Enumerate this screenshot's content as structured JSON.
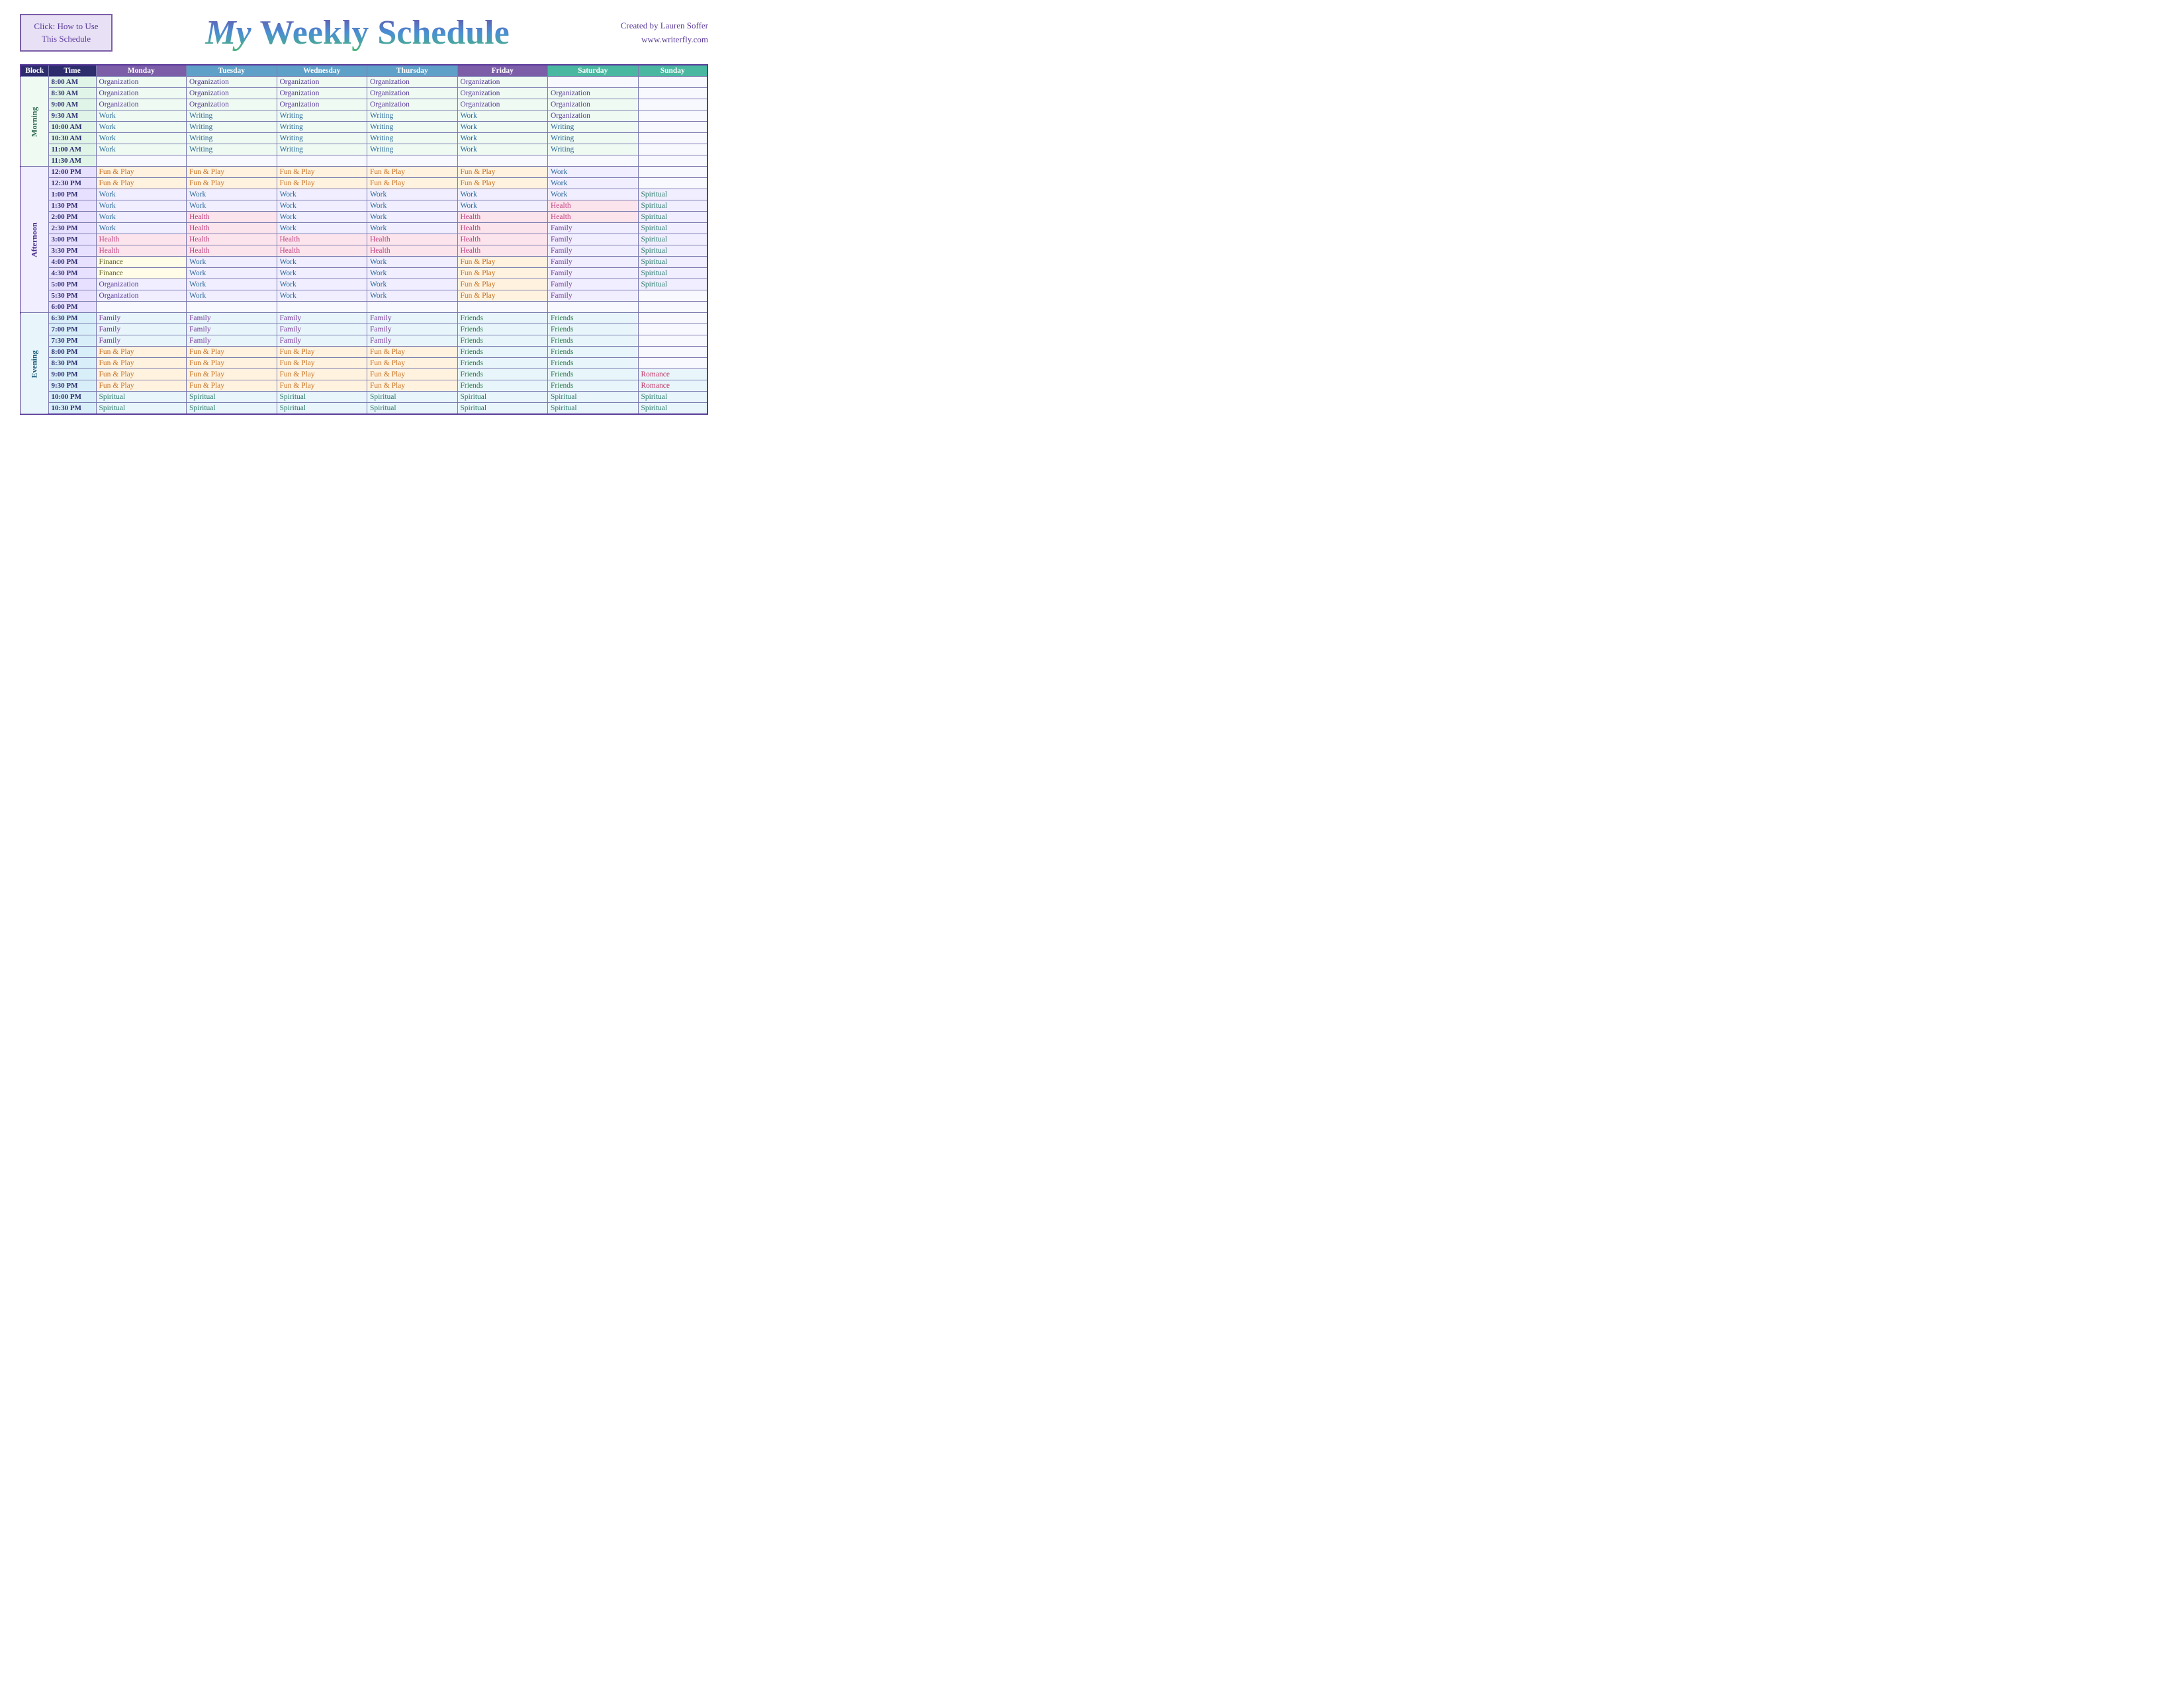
{
  "header": {
    "click_box_line1": "Click:  How to Use",
    "click_box_line2": "This Schedule",
    "title": "My Weekly Schedule",
    "credit_line1": "Created by Lauren Soffer",
    "credit_line2": "www.writerfly.com"
  },
  "table": {
    "columns": [
      "Block",
      "Time",
      "Monday",
      "Tuesday",
      "Wednesday",
      "Thursday",
      "Friday",
      "Saturday",
      "Sunday"
    ],
    "blocks": {
      "morning": "Morning",
      "afternoon": "Afternoon",
      "evening": "Evening"
    },
    "rows": [
      {
        "block": "morning",
        "time": "8:00 AM",
        "mon": "Organization",
        "tue": "Organization",
        "wed": "Organization",
        "thu": "Organization",
        "fri": "Organization",
        "sat": "",
        "sun": ""
      },
      {
        "block": "morning",
        "time": "8:30 AM",
        "mon": "Organization",
        "tue": "Organization",
        "wed": "Organization",
        "thu": "Organization",
        "fri": "Organization",
        "sat": "Organization",
        "sun": ""
      },
      {
        "block": "morning",
        "time": "9:00 AM",
        "mon": "Organization",
        "tue": "Organization",
        "wed": "Organization",
        "thu": "Organization",
        "fri": "Organization",
        "sat": "Organization",
        "sun": ""
      },
      {
        "block": "morning",
        "time": "9:30 AM",
        "mon": "Work",
        "tue": "Writing",
        "wed": "Writing",
        "thu": "Writing",
        "fri": "Work",
        "sat": "Organization",
        "sun": ""
      },
      {
        "block": "morning",
        "time": "10:00 AM",
        "mon": "Work",
        "tue": "Writing",
        "wed": "Writing",
        "thu": "Writing",
        "fri": "Work",
        "sat": "Writing",
        "sun": ""
      },
      {
        "block": "morning",
        "time": "10:30 AM",
        "mon": "Work",
        "tue": "Writing",
        "wed": "Writing",
        "thu": "Writing",
        "fri": "Work",
        "sat": "Writing",
        "sun": ""
      },
      {
        "block": "morning",
        "time": "11:00 AM",
        "mon": "Work",
        "tue": "Writing",
        "wed": "Writing",
        "thu": "Writing",
        "fri": "Work",
        "sat": "Writing",
        "sun": ""
      },
      {
        "block": "morning",
        "time": "11:30 AM",
        "mon": "",
        "tue": "",
        "wed": "",
        "thu": "",
        "fri": "",
        "sat": "",
        "sun": ""
      },
      {
        "block": "afternoon",
        "time": "12:00 PM",
        "mon": "Fun & Play",
        "tue": "Fun & Play",
        "wed": "Fun & Play",
        "thu": "Fun & Play",
        "fri": "Fun & Play",
        "sat": "Work",
        "sun": ""
      },
      {
        "block": "afternoon",
        "time": "12:30 PM",
        "mon": "Fun & Play",
        "tue": "Fun & Play",
        "wed": "Fun & Play",
        "thu": "Fun & Play",
        "fri": "Fun & Play",
        "sat": "Work",
        "sun": ""
      },
      {
        "block": "afternoon",
        "time": "1:00 PM",
        "mon": "Work",
        "tue": "Work",
        "wed": "Work",
        "thu": "Work",
        "fri": "Work",
        "sat": "Work",
        "sun": "Spiritual"
      },
      {
        "block": "afternoon",
        "time": "1:30 PM",
        "mon": "Work",
        "tue": "Work",
        "wed": "Work",
        "thu": "Work",
        "fri": "Work",
        "sat": "Health",
        "sun": "Spiritual"
      },
      {
        "block": "afternoon",
        "time": "2:00 PM",
        "mon": "Work",
        "tue": "Health",
        "wed": "Work",
        "thu": "Work",
        "fri": "Health",
        "sat": "Health",
        "sun": "Spiritual"
      },
      {
        "block": "afternoon",
        "time": "2:30 PM",
        "mon": "Work",
        "tue": "Health",
        "wed": "Work",
        "thu": "Work",
        "fri": "Health",
        "sat": "Family",
        "sun": "Spiritual"
      },
      {
        "block": "afternoon",
        "time": "3:00 PM",
        "mon": "Health",
        "tue": "Health",
        "wed": "Health",
        "thu": "Health",
        "fri": "Health",
        "sat": "Family",
        "sun": "Spiritual"
      },
      {
        "block": "afternoon",
        "time": "3:30 PM",
        "mon": "Health",
        "tue": "Health",
        "wed": "Health",
        "thu": "Health",
        "fri": "Health",
        "sat": "Family",
        "sun": "Spiritual"
      },
      {
        "block": "afternoon",
        "time": "4:00 PM",
        "mon": "Finance",
        "tue": "Work",
        "wed": "Work",
        "thu": "Work",
        "fri": "Fun & Play",
        "sat": "Family",
        "sun": "Spiritual"
      },
      {
        "block": "afternoon",
        "time": "4:30 PM",
        "mon": "Finance",
        "tue": "Work",
        "wed": "Work",
        "thu": "Work",
        "fri": "Fun & Play",
        "sat": "Family",
        "sun": "Spiritual"
      },
      {
        "block": "afternoon",
        "time": "5:00 PM",
        "mon": "Organization",
        "tue": "Work",
        "wed": "Work",
        "thu": "Work",
        "fri": "Fun & Play",
        "sat": "Family",
        "sun": "Spiritual"
      },
      {
        "block": "afternoon",
        "time": "5:30 PM",
        "mon": "Organization",
        "tue": "Work",
        "wed": "Work",
        "thu": "Work",
        "fri": "Fun & Play",
        "sat": "Family",
        "sun": ""
      },
      {
        "block": "afternoon",
        "time": "6:00 PM",
        "mon": "",
        "tue": "",
        "wed": "",
        "thu": "",
        "fri": "",
        "sat": "",
        "sun": ""
      },
      {
        "block": "evening",
        "time": "6:30 PM",
        "mon": "Family",
        "tue": "Family",
        "wed": "Family",
        "thu": "Family",
        "fri": "Friends",
        "sat": "Friends",
        "sun": ""
      },
      {
        "block": "evening",
        "time": "7:00 PM",
        "mon": "Family",
        "tue": "Family",
        "wed": "Family",
        "thu": "Family",
        "fri": "Friends",
        "sat": "Friends",
        "sun": ""
      },
      {
        "block": "evening",
        "time": "7:30 PM",
        "mon": "Family",
        "tue": "Family",
        "wed": "Family",
        "thu": "Family",
        "fri": "Friends",
        "sat": "Friends",
        "sun": ""
      },
      {
        "block": "evening",
        "time": "8:00 PM",
        "mon": "Fun & Play",
        "tue": "Fun & Play",
        "wed": "Fun & Play",
        "thu": "Fun & Play",
        "fri": "Friends",
        "sat": "Friends",
        "sun": ""
      },
      {
        "block": "evening",
        "time": "8:30 PM",
        "mon": "Fun & Play",
        "tue": "Fun & Play",
        "wed": "Fun & Play",
        "thu": "Fun & Play",
        "fri": "Friends",
        "sat": "Friends",
        "sun": ""
      },
      {
        "block": "evening",
        "time": "9:00 PM",
        "mon": "Fun & Play",
        "tue": "Fun & Play",
        "wed": "Fun & Play",
        "thu": "Fun & Play",
        "fri": "Friends",
        "sat": "Friends",
        "sun": "Romance"
      },
      {
        "block": "evening",
        "time": "9:30 PM",
        "mon": "Fun & Play",
        "tue": "Fun & Play",
        "wed": "Fun & Play",
        "thu": "Fun & Play",
        "fri": "Friends",
        "sat": "Friends",
        "sun": "Romance"
      },
      {
        "block": "evening",
        "time": "10:00 PM",
        "mon": "Spiritual",
        "tue": "Spiritual",
        "wed": "Spiritual",
        "thu": "Spiritual",
        "fri": "Spiritual",
        "sat": "Spiritual",
        "sun": "Spiritual"
      },
      {
        "block": "evening",
        "time": "10:30 PM",
        "mon": "Spiritual",
        "tue": "Spiritual",
        "wed": "Spiritual",
        "thu": "Spiritual",
        "fri": "Spiritual",
        "sat": "Spiritual",
        "sun": "Spiritual"
      }
    ]
  }
}
